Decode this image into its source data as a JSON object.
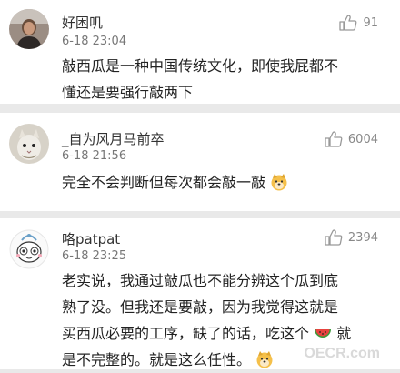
{
  "comments": [
    {
      "user": "好困叽",
      "time": "6-18 23:04",
      "likes": "91",
      "lines": [
        "敲西瓜是一种中国传统文化，即使我屁都不",
        "懂还是要强行敲两下"
      ]
    },
    {
      "user": "_自为风月马前卒",
      "time": "6-18 21:56",
      "likes": "6004",
      "lines": [
        "完全不会判断但每次都会敲一敲"
      ]
    },
    {
      "user": "咯patpat",
      "time": "6-18 23:25",
      "likes": "2394",
      "lines": [
        "老实说，我通过敲瓜也不能分辨这个瓜到底",
        "熟了没。但我还是要敲，因为我觉得这就是",
        "买西瓜必要的工序，缺了的话，吃这个",
        "就",
        "是不完整的。就是这么任性。"
      ]
    }
  ],
  "icons": {
    "like": "thumbs-up-icon",
    "doge": "doge-emoji-icon",
    "watermelon": "watermelon-emoji-icon"
  },
  "watermark": "OECR.com"
}
